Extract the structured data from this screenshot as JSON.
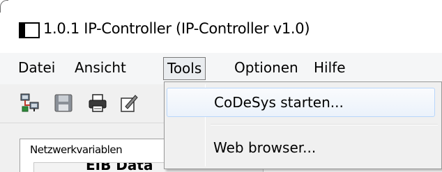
{
  "window": {
    "title": "1.0.1  IP-Controller (IP-Controller v1.0)"
  },
  "menu": {
    "items": [
      {
        "label": "Datei"
      },
      {
        "label": "Ansicht"
      },
      {
        "label": "Tools",
        "active": true
      },
      {
        "label": "Optionen"
      },
      {
        "label": "Hilfe"
      }
    ]
  },
  "toolbar": {
    "buttons": [
      {
        "icon": "network-icon"
      },
      {
        "icon": "save-icon"
      },
      {
        "icon": "print-icon"
      },
      {
        "icon": "edit-icon"
      }
    ]
  },
  "tabs": [
    {
      "label": "Netzwerkvariablen"
    }
  ],
  "grid": {
    "column_header": "EIB Data"
  },
  "tools_menu": {
    "items": [
      {
        "label": "CoDeSys starten...",
        "highlighted": true
      },
      {
        "label": "Web browser..."
      }
    ]
  },
  "colors": {
    "menu_highlight_border": "#b8d6fb",
    "menu_background": "#f0f0f0",
    "active_menu_border": "#7a7a7a"
  }
}
